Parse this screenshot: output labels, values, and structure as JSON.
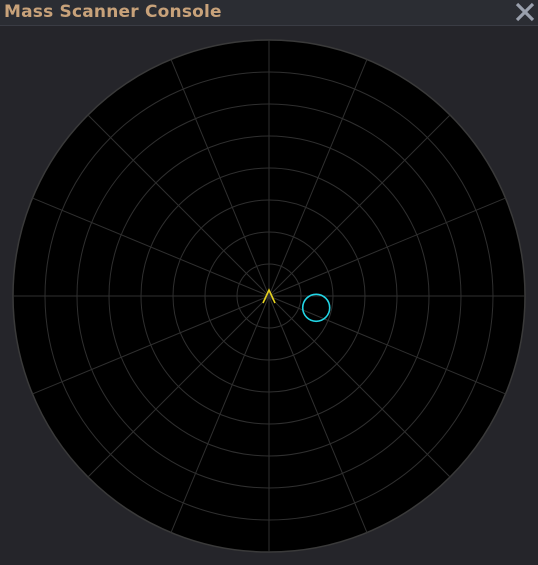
{
  "window": {
    "title": "Mass Scanner Console",
    "title_color": "#c8a27a",
    "close_icon": "close-icon",
    "close_color": "#9aa0ad"
  },
  "scanner": {
    "background": "#000000",
    "rim_color": "#3a3a3a",
    "grid_color": "#2f2f2f",
    "ring_count": 8,
    "spoke_count": 16,
    "ship_icon": "ship-marker-icon",
    "ship_color": "#e6d21e",
    "contacts": [
      {
        "name": "mass-contact",
        "bearing_deg": 104,
        "range_fraction": 0.19,
        "color": "#22d6e6"
      }
    ]
  }
}
